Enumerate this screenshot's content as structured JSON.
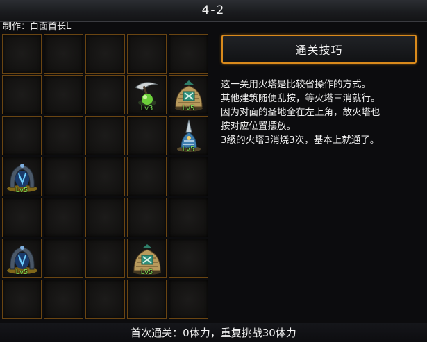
{
  "header": {
    "title": "4-2"
  },
  "author": {
    "label": "制作：白面首长L"
  },
  "tips": {
    "button_label": "通关技巧",
    "lines": [
      "这一关用火塔是比较省操作的方式。",
      "其他建筑随便乱按，等火塔三消就行。",
      "因为对面的圣地全在左上角，故火塔也",
      "按对应位置摆放。",
      "3级的火塔3消烧3次，基本上就通了。"
    ]
  },
  "footer": {
    "text": "首次通关：0体力，重复挑战30体力"
  },
  "board": {
    "rows": 7,
    "cols": 5,
    "units": [
      {
        "row": 1,
        "col": 3,
        "type": "scythe-tower",
        "level": "Lv3"
      },
      {
        "row": 1,
        "col": 4,
        "type": "hut-building",
        "level": "Lv5"
      },
      {
        "row": 2,
        "col": 4,
        "type": "fire-tower",
        "level": "Lv5"
      },
      {
        "row": 3,
        "col": 0,
        "type": "portal-gate",
        "level": "Lv5"
      },
      {
        "row": 5,
        "col": 0,
        "type": "portal-gate",
        "level": "Lv5"
      },
      {
        "row": 5,
        "col": 3,
        "type": "hut-building",
        "level": "Lv5"
      }
    ]
  },
  "colors": {
    "cell_border": "#6a4512",
    "button_border": "#d98a1c",
    "level_text": "#7fe35a"
  }
}
